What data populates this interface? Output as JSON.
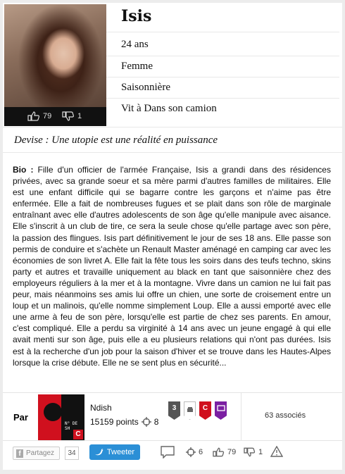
{
  "profile": {
    "name": "Isis",
    "attributes": [
      "24 ans",
      "Femme",
      "Saisonnière",
      "Vit à Dans son camion"
    ],
    "votes_up": "79",
    "votes_down": "1",
    "devise": "Devise : Une utopie est une réalité en puissance"
  },
  "bio": {
    "label": "Bio :",
    "text": " Fille d'un officier de l'armée Française, Isis a grandi dans des résidences privées, avec sa grande soeur et sa mère parmi d'autres familles de militaires. Elle est une enfant difficile qui se bagarre contre les garçons et n'aime pas être enfermée. Elle a fait de nombreuses fugues et se plait dans son rôle de marginale entraînant avec elle d'autres adolescents de son âge qu'elle manipule avec aisance. Elle s'inscrit à un club de tire, ce sera la seule chose qu'elle partage avec son père, la passion des flingues. Isis part définitivement le jour de ses 18 ans. Elle passe son permis de conduire et s'achète un Renault Master aménagé en camping car avec les économies de son livret A. Elle fait la fête tous les soirs dans des teufs techno, skins party et autres et travaille uniquement au black en tant que saisonnière chez des employeurs réguliers à la mer et à la montagne. Vivre dans un camion ne lui fait pas peur, mais néanmoins ses amis lui offre un chien, une sorte de croisement entre un loup et un malinois, qu'elle nomme simplement Loup. Elle a aussi emporté avec elle une arme à feu de son père, lorsqu'elle est partie de chez ses parents. En amour, c'est compliqué. Elle a perdu sa virginité à 14 ans avec un jeune engagé à qui elle avait menti sur son âge, puis elle a eu plusieurs relations qui n'ont pas durées. Isis est à la recherche d'un job pour la saison d'hiver et se trouve dans les Hautes-Alpes lorsque la crise débute. Elle ne se sent plus en sécurité..."
  },
  "author": {
    "par_label": "Par",
    "username": "Ndish",
    "points": "15159 points",
    "target_count": "8",
    "avatar_text": "N° DE SH",
    "avatar_letter": "C",
    "badges": [
      {
        "label": "3",
        "color": "#555555"
      },
      {
        "label": "",
        "color": "#ffffff"
      },
      {
        "label": "C",
        "color": "#d0101e"
      },
      {
        "label": "",
        "color": "#7b1fa2"
      }
    ],
    "associates": "63 associés"
  },
  "footer": {
    "share_label": "Partagez",
    "share_count": "34",
    "tweet_label": "Tweeter",
    "targets": "6",
    "likes": "79",
    "dislikes": "1"
  },
  "colors": {
    "accent_red": "#d0101e",
    "tweet_blue": "#2b8fd6"
  }
}
